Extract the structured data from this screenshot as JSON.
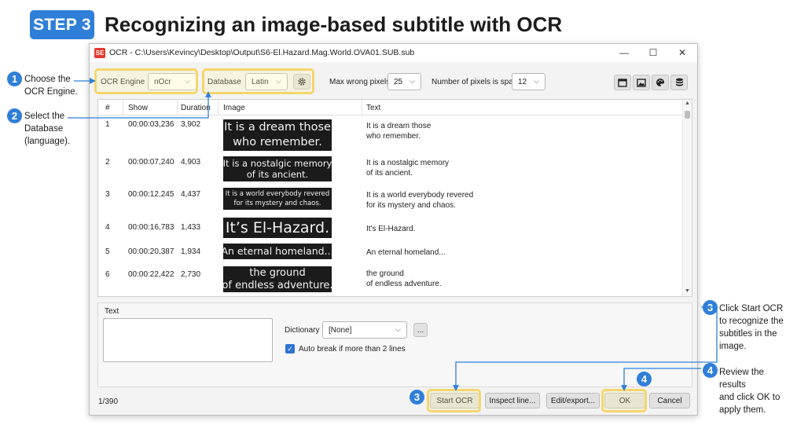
{
  "header": {
    "step": "STEP 3",
    "title": "Recognizing an image-based subtitle with OCR"
  },
  "callouts": {
    "c1": {
      "num": "1",
      "lines": [
        "Choose the",
        "OCR Engine."
      ]
    },
    "c2": {
      "num": "2",
      "lines": [
        "Select the",
        "Database",
        "(language)."
      ]
    },
    "c3": {
      "num": "3",
      "lines": [
        "Click Start OCR",
        "to recognize the",
        "subtitles in the",
        "image."
      ]
    },
    "c4": {
      "num": "4",
      "lines": [
        "Review the results",
        "and click OK to",
        "apply them."
      ]
    },
    "c3_marker": "3",
    "c4_marker": "4"
  },
  "window": {
    "app_icon": "SE",
    "title": "OCR - C:\\Users\\Kevincy\\Desktop\\Output\\S6-El.Hazard.Mag.World.OVA01.SUB.sub",
    "controls": {
      "minimize": "—",
      "maximize": "☐",
      "close": "✕"
    }
  },
  "toolbar": {
    "ocr_engine_label": "OCR Engine",
    "ocr_engine_value": "nOcr",
    "database_label": "Database",
    "database_value": "Latin",
    "max_wrong_label": "Max wrong pixels",
    "max_wrong_value": "25",
    "pixels_space_label": "Number of pixels is space",
    "pixels_space_value": "12",
    "icons": [
      "window-icon",
      "image-icon",
      "palette-icon",
      "database-icon"
    ]
  },
  "grid": {
    "columns": [
      "#",
      "Show",
      "Duration",
      "Image",
      "Text"
    ],
    "rows": [
      {
        "num": "1",
        "show": "00:00:03,236",
        "duration": "3,902",
        "image_lines": [
          "It is a dream those",
          "who remember."
        ],
        "text_lines": [
          "It is a dream those",
          "who remember."
        ]
      },
      {
        "num": "2",
        "show": "00:00:07,240",
        "duration": "4,903",
        "image_lines": [
          "It is a nostalgic memory",
          "of its ancient."
        ],
        "text_lines": [
          "It is a nostalgic memory",
          "of its ancient."
        ]
      },
      {
        "num": "3",
        "show": "00:00:12,245",
        "duration": "4,437",
        "image_lines": [
          "It is a world everybody revered",
          "for its mystery and chaos."
        ],
        "text_lines": [
          "It is a world everybody revered",
          "for its mystery and chaos."
        ]
      },
      {
        "num": "4",
        "show": "00:00:16,783",
        "duration": "1,433",
        "image_lines": [
          "It’s El-Hazard."
        ],
        "text_lines": [
          "It's El-Hazard."
        ]
      },
      {
        "num": "5",
        "show": "00:00:20,387",
        "duration": "1,934",
        "image_lines": [
          "An eternal homeland..."
        ],
        "text_lines": [
          "An eternal homeland..."
        ]
      },
      {
        "num": "6",
        "show": "00:00:22,422",
        "duration": "2,730",
        "image_lines": [
          "the ground",
          "of endless adventure."
        ],
        "text_lines": [
          "the ground",
          "of endless adventure."
        ]
      }
    ]
  },
  "lower": {
    "text_label": "Text",
    "dictionary_label": "Dictionary",
    "dictionary_value": "[None]",
    "dictionary_more": "...",
    "auto_break_label": "Auto break if more than 2 lines",
    "auto_break_checked": true
  },
  "buttons": {
    "start_ocr": "Start OCR",
    "inspect": "Inspect line...",
    "edit_export": "Edit/export...",
    "ok": "OK",
    "cancel": "Cancel"
  },
  "status": "1/390",
  "colors": {
    "accent": "#2f7fd8",
    "highlight": "#f5d66e"
  }
}
